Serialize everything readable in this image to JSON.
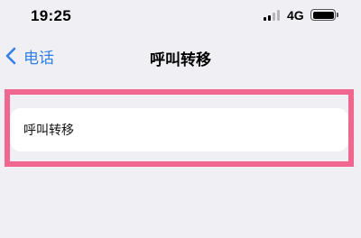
{
  "status_bar": {
    "time": "19:25",
    "network": "4G",
    "signal_bars_active": 2,
    "signal_bars_total": 4,
    "battery_level": 1.0
  },
  "nav": {
    "back_label": "电话",
    "title": "呼叫转移",
    "accent_color": "#2f80ed"
  },
  "list": {
    "items": [
      {
        "label": "呼叫转移"
      }
    ]
  },
  "highlight": {
    "color": "#f0668f"
  },
  "icons": [
    "cellular-signal-icon",
    "battery-icon",
    "chevron-left-icon"
  ]
}
